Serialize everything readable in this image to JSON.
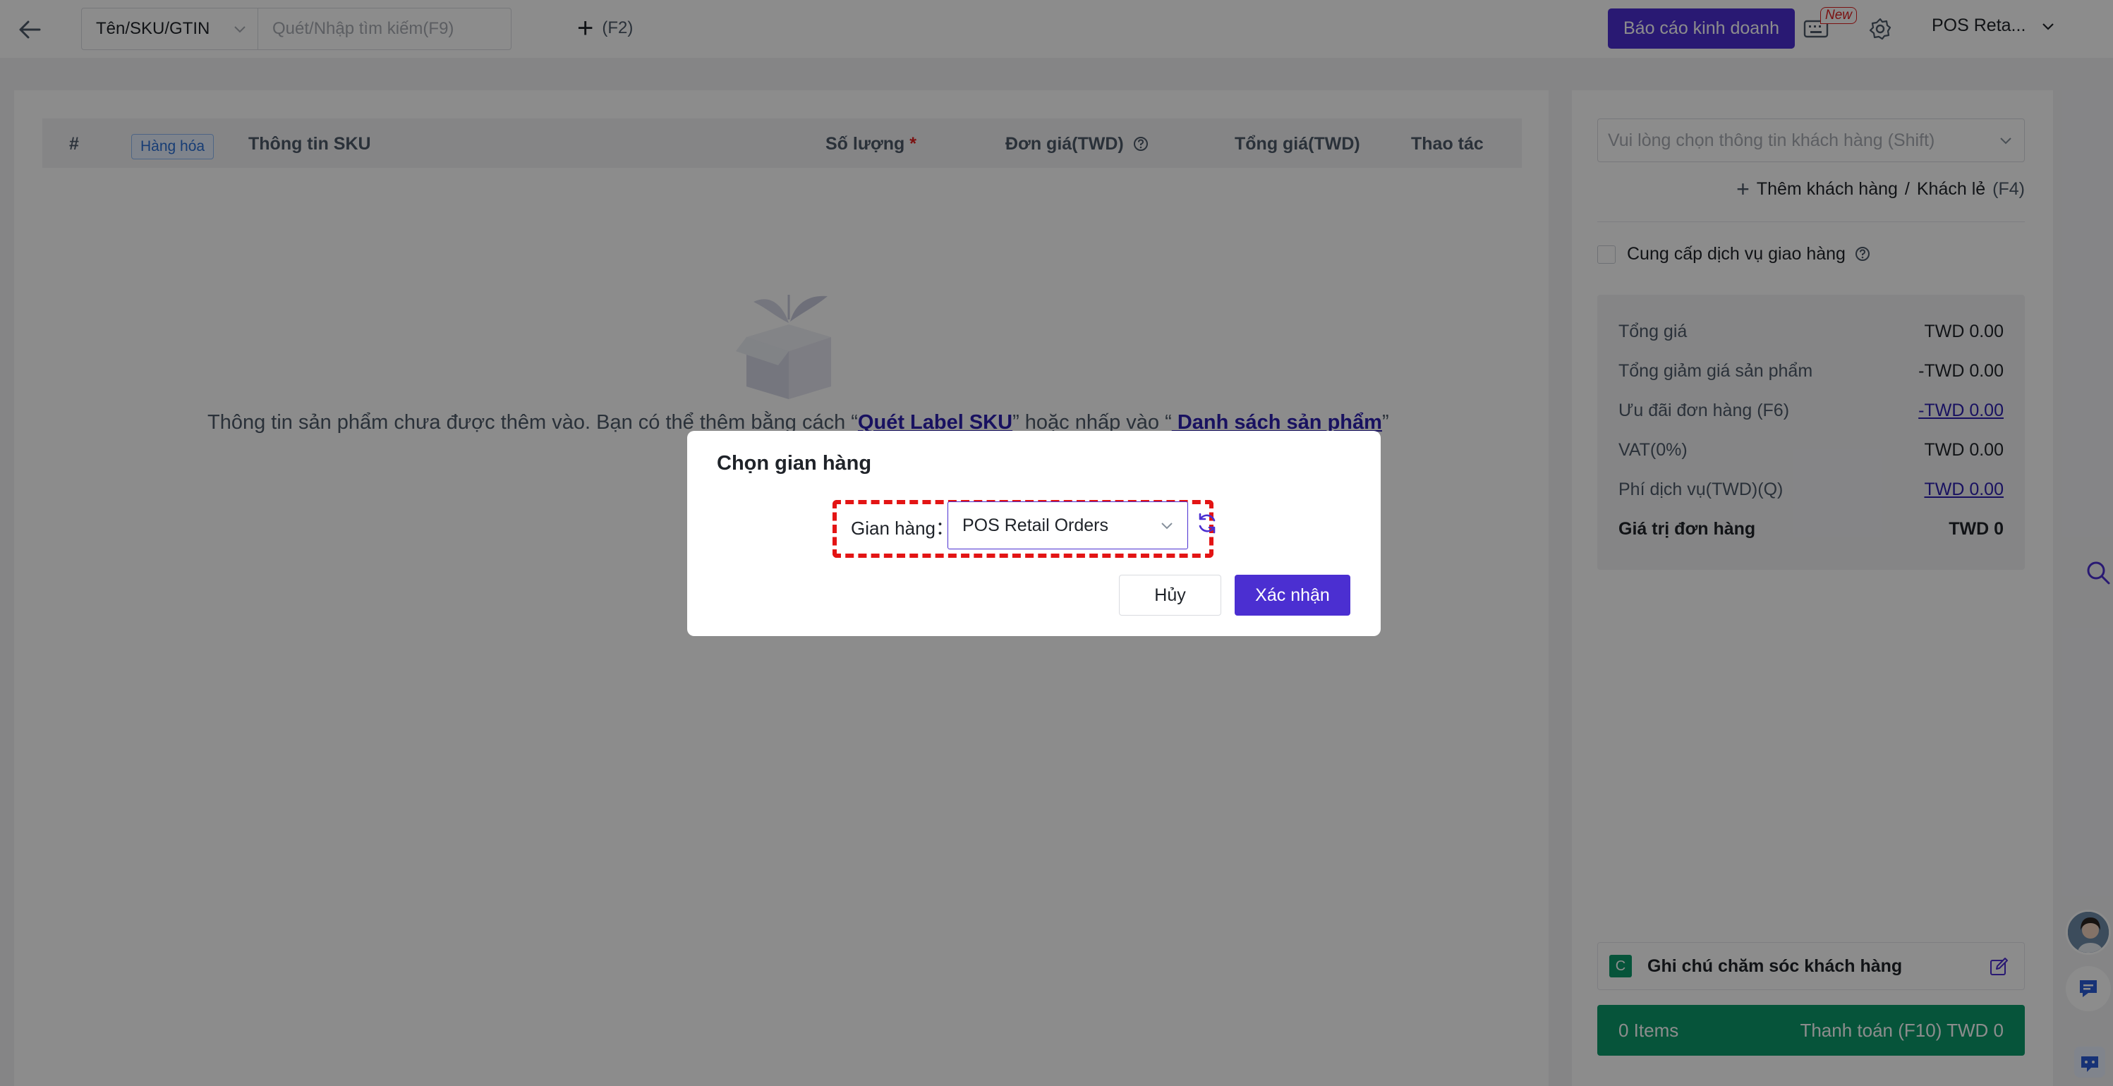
{
  "topbar": {
    "search_type": "Tên/SKU/GTIN",
    "search_placeholder": "Quét/Nhập tìm kiếm(F9)",
    "add_order_shortcut": "(F2)",
    "report_button": "Báo cáo kinh doanh",
    "new_badge": "New",
    "store_name": "POS Reta..."
  },
  "table": {
    "col_index": "#",
    "goods_tag": "Hàng hóa",
    "col_sku": "Thông tin SKU",
    "col_qty": "Số lượng",
    "required_mark": "*",
    "col_unit_price": "Đơn giá(TWD)",
    "col_total": "Tổng giá(TWD)",
    "col_action": "Thao tác"
  },
  "empty_state": {
    "text_before": "Thông tin sản phẩm chưa được thêm vào. Bạn có thể thêm bằng cách “",
    "link_scan": "Quét Label SKU",
    "text_middle": "” hoặc nhấp vào “",
    "link_products": " Danh sách sản phẩm",
    "text_after": "”"
  },
  "right_panel": {
    "customer_placeholder": "Vui lòng chọn thông tin khách hàng (Shift)",
    "add_customer": "Thêm khách hàng",
    "separator": "/",
    "walk_in": "Khách lẻ",
    "walk_in_shortcut": "(F4)",
    "delivery_label": "Cung cấp dịch vụ giao hàng",
    "summary": [
      {
        "label": "Tổng giá",
        "value": "TWD 0.00"
      },
      {
        "label": "Tổng giảm giá sản phẩm",
        "value": "-TWD 0.00"
      },
      {
        "label": "Ưu đãi đơn hàng (F6)",
        "value": "-TWD 0.00"
      },
      {
        "label": "VAT(0%)",
        "value": "TWD 0.00"
      },
      {
        "label": "Phí dịch vụ(TWD)(Q)",
        "value": "TWD 0.00"
      },
      {
        "label": "Giá trị đơn hàng",
        "value": "TWD 0"
      }
    ],
    "notes_badge": "C",
    "notes_label": "Ghi chú chăm sóc khách hàng",
    "items_count": "0 Items",
    "pay_label": "Thanh toán (F10) TWD 0"
  },
  "dialog": {
    "title": "Chọn gian hàng",
    "store_label": "Gian hàng：",
    "store_value": "POS Retail Orders",
    "cancel": "Hủy",
    "confirm": "Xác nhận"
  },
  "colors": {
    "primary": "#4b2fd1",
    "success": "#0b9a6b",
    "highlight": "#e31414",
    "link": "#2d1fb0"
  }
}
